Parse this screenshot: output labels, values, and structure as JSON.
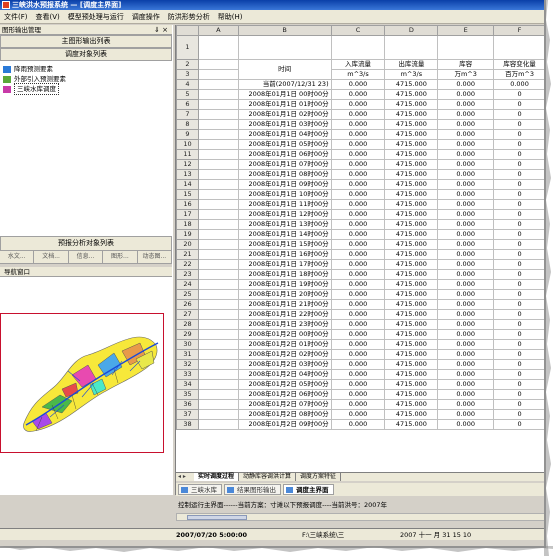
{
  "window": {
    "title": "三峡洪水预报系统 — [调度主界面]"
  },
  "menu": [
    "文件(F)",
    "查看(V)",
    "模型预处理与运行",
    "调度操作",
    "防洪形势分析",
    "帮助(H)"
  ],
  "left_panel": {
    "header": "图形输出管理",
    "pin_glyph": "⇓ ×",
    "button_main": "主图形输出列表",
    "button_dispatch": "调度对象列表",
    "tree": [
      {
        "label": "降雨预测要素",
        "icon_color": "#2a7ad8"
      },
      {
        "label": "外部引入预测要素",
        "icon_color": "#5aa83a"
      },
      {
        "label": "三峡水库调度",
        "icon_color": "#c83aa8",
        "selected": true
      }
    ],
    "analysis_button": "预报分析对象列表",
    "subtabs": [
      "水文...",
      "文档...",
      "信息...",
      "图形...",
      "动态图..."
    ],
    "nav_header": "导航窗口"
  },
  "sheet": {
    "col_headers": [
      "A",
      "B",
      "C",
      "D",
      "E",
      "F"
    ],
    "headers": {
      "time": "时间",
      "inflow": "入库流量",
      "outflow": "出库流量",
      "storage": "库容",
      "storage_change": "库容变化量",
      "unit_flow": "m^3/s",
      "unit_storage": "万m^3",
      "unit_change": "百万m^3"
    },
    "rows": [
      {
        "n": "4",
        "time": "当前(2007/12/31 23)",
        "c": "0.000",
        "d": "4715.000",
        "e": "0.000",
        "f": "0.000"
      },
      {
        "n": "5",
        "time": "2008年01月1日 00时00分",
        "c": "0.000",
        "d": "4715.000",
        "e": "0.000",
        "f": "0"
      },
      {
        "n": "6",
        "time": "2008年01月1日 01时00分",
        "c": "0.000",
        "d": "4715.000",
        "e": "0.000",
        "f": "0"
      },
      {
        "n": "7",
        "time": "2008年01月1日 02时00分",
        "c": "0.000",
        "d": "4715.000",
        "e": "0.000",
        "f": "0"
      },
      {
        "n": "8",
        "time": "2008年01月1日 03时00分",
        "c": "0.000",
        "d": "4715.000",
        "e": "0.000",
        "f": "0"
      },
      {
        "n": "9",
        "time": "2008年01月1日 04时00分",
        "c": "0.000",
        "d": "4715.000",
        "e": "0.000",
        "f": "0"
      },
      {
        "n": "10",
        "time": "2008年01月1日 05时00分",
        "c": "0.000",
        "d": "4715.000",
        "e": "0.000",
        "f": "0"
      },
      {
        "n": "11",
        "time": "2008年01月1日 06时00分",
        "c": "0.000",
        "d": "4715.000",
        "e": "0.000",
        "f": "0"
      },
      {
        "n": "12",
        "time": "2008年01月1日 07时00分",
        "c": "0.000",
        "d": "4715.000",
        "e": "0.000",
        "f": "0"
      },
      {
        "n": "13",
        "time": "2008年01月1日 08时00分",
        "c": "0.000",
        "d": "4715.000",
        "e": "0.000",
        "f": "0"
      },
      {
        "n": "14",
        "time": "2008年01月1日 09时00分",
        "c": "0.000",
        "d": "4715.000",
        "e": "0.000",
        "f": "0"
      },
      {
        "n": "15",
        "time": "2008年01月1日 10时00分",
        "c": "0.000",
        "d": "4715.000",
        "e": "0.000",
        "f": "0"
      },
      {
        "n": "16",
        "time": "2008年01月1日 11时00分",
        "c": "0.000",
        "d": "4715.000",
        "e": "0.000",
        "f": "0"
      },
      {
        "n": "17",
        "time": "2008年01月1日 12时00分",
        "c": "0.000",
        "d": "4715.000",
        "e": "0.000",
        "f": "0"
      },
      {
        "n": "18",
        "time": "2008年01月1日 13时00分",
        "c": "0.000",
        "d": "4715.000",
        "e": "0.000",
        "f": "0"
      },
      {
        "n": "19",
        "time": "2008年01月1日 14时00分",
        "c": "0.000",
        "d": "4715.000",
        "e": "0.000",
        "f": "0"
      },
      {
        "n": "20",
        "time": "2008年01月1日 15时00分",
        "c": "0.000",
        "d": "4715.000",
        "e": "0.000",
        "f": "0"
      },
      {
        "n": "21",
        "time": "2008年01月1日 16时00分",
        "c": "0.000",
        "d": "4715.000",
        "e": "0.000",
        "f": "0"
      },
      {
        "n": "22",
        "time": "2008年01月1日 17时00分",
        "c": "0.000",
        "d": "4715.000",
        "e": "0.000",
        "f": "0"
      },
      {
        "n": "23",
        "time": "2008年01月1日 18时00分",
        "c": "0.000",
        "d": "4715.000",
        "e": "0.000",
        "f": "0"
      },
      {
        "n": "24",
        "time": "2008年01月1日 19时00分",
        "c": "0.000",
        "d": "4715.000",
        "e": "0.000",
        "f": "0"
      },
      {
        "n": "25",
        "time": "2008年01月1日 20时00分",
        "c": "0.000",
        "d": "4715.000",
        "e": "0.000",
        "f": "0"
      },
      {
        "n": "26",
        "time": "2008年01月1日 21时00分",
        "c": "0.000",
        "d": "4715.000",
        "e": "0.000",
        "f": "0"
      },
      {
        "n": "27",
        "time": "2008年01月1日 22时00分",
        "c": "0.000",
        "d": "4715.000",
        "e": "0.000",
        "f": "0"
      },
      {
        "n": "28",
        "time": "2008年01月1日 23时00分",
        "c": "0.000",
        "d": "4715.000",
        "e": "0.000",
        "f": "0"
      },
      {
        "n": "29",
        "time": "2008年01月2日 00时00分",
        "c": "0.000",
        "d": "4715.000",
        "e": "0.000",
        "f": "0"
      },
      {
        "n": "30",
        "time": "2008年01月2日 01时00分",
        "c": "0.000",
        "d": "4715.000",
        "e": "0.000",
        "f": "0"
      },
      {
        "n": "31",
        "time": "2008年01月2日 02时00分",
        "c": "0.000",
        "d": "4715.000",
        "e": "0.000",
        "f": "0"
      },
      {
        "n": "32",
        "time": "2008年01月2日 03时00分",
        "c": "0.000",
        "d": "4715.000",
        "e": "0.000",
        "f": "0"
      },
      {
        "n": "33",
        "time": "2008年01月2日 04时00分",
        "c": "0.000",
        "d": "4715.000",
        "e": "0.000",
        "f": "0"
      },
      {
        "n": "34",
        "time": "2008年01月2日 05时00分",
        "c": "0.000",
        "d": "4715.000",
        "e": "0.000",
        "f": "0"
      },
      {
        "n": "35",
        "time": "2008年01月2日 06时00分",
        "c": "0.000",
        "d": "4715.000",
        "e": "0.000",
        "f": "0"
      },
      {
        "n": "36",
        "time": "2008年01月2日 07时00分",
        "c": "0.000",
        "d": "4715.000",
        "e": "0.000",
        "f": "0"
      },
      {
        "n": "37",
        "time": "2008年01月2日 08时00分",
        "c": "0.000",
        "d": "4715.000",
        "e": "0.000",
        "f": "0"
      },
      {
        "n": "38",
        "time": "2008年01月2日 09时00分",
        "c": "0.000",
        "d": "4715.000",
        "e": "0.000",
        "f": "0"
      }
    ]
  },
  "sheet_tabs": {
    "nav": "◂ ▸",
    "tabs": [
      "实时调度过程",
      "动静库容调洪计算",
      "调度方案特征"
    ]
  },
  "doc_tabs": [
    "三峡水库",
    "结果图形输出",
    "调度主界面"
  ],
  "status_text": "控制运行主界面------当前方案：寸滩以下预报调度----当前洪号：2007年",
  "status_bar": {
    "datetime": "2007/07/20 5:00:00",
    "path": "F:\\三峡系统\\三",
    "end_date": "2007 十一 月 31 15 10"
  },
  "colors": {
    "titlebar": "#0a3fa8",
    "map_frame": "#c8102e",
    "map_fill": "#f7e83a"
  }
}
